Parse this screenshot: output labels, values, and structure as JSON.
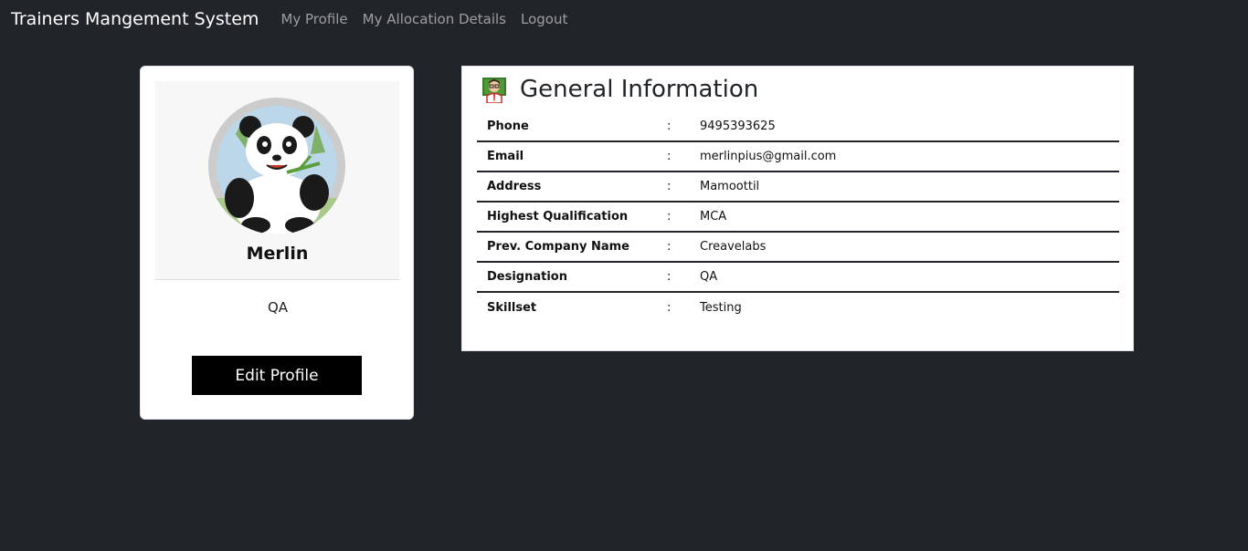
{
  "navbar": {
    "brand": "Trainers Mangement System",
    "links": [
      "My Profile",
      "My Allocation Details",
      "Logout"
    ]
  },
  "profile": {
    "name": "Merlin",
    "role": "QA",
    "edit_label": "Edit Profile",
    "avatar_icon": "panda-avatar-icon"
  },
  "info": {
    "title": "General Information",
    "icon": "teacher-icon",
    "separator": ":",
    "rows": [
      {
        "label": "Phone",
        "value": "9495393625"
      },
      {
        "label": "Email",
        "value": "merlinpius@gmail.com"
      },
      {
        "label": "Address",
        "value": "Mamoottil"
      },
      {
        "label": "Highest Qualification",
        "value": "MCA"
      },
      {
        "label": "Prev. Company Name",
        "value": "Creavelabs"
      },
      {
        "label": "Designation",
        "value": "QA"
      },
      {
        "label": "Skillset",
        "value": "Testing"
      }
    ]
  },
  "colors": {
    "background": "#212529",
    "card": "#ffffff",
    "button": "#000000"
  }
}
